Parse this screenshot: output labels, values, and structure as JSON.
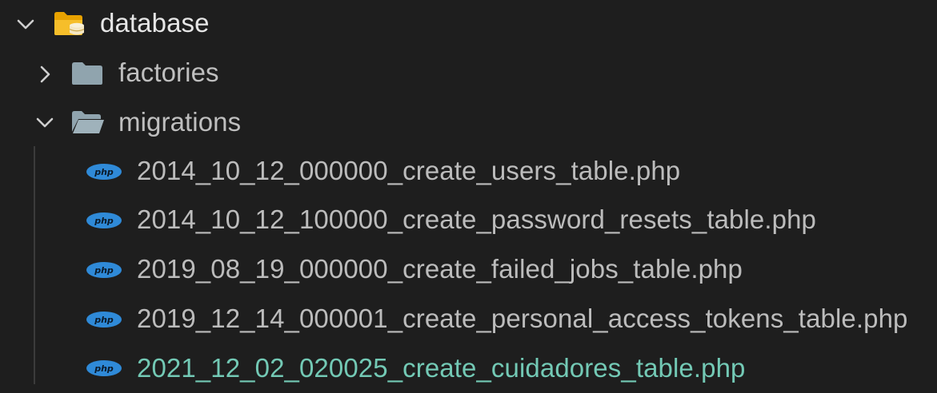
{
  "explorer": {
    "root": {
      "name": "database",
      "expanded": true,
      "icon": "database-folder-icon"
    },
    "folders": [
      {
        "name": "factories",
        "expanded": false,
        "icon": "folder-icon"
      },
      {
        "name": "migrations",
        "expanded": true,
        "icon": "folder-open-icon"
      }
    ],
    "files": [
      {
        "name": "2014_10_12_000000_create_users_table.php",
        "icon": "php-icon",
        "status": "normal"
      },
      {
        "name": "2014_10_12_100000_create_password_resets_table.php",
        "icon": "php-icon",
        "status": "normal"
      },
      {
        "name": "2019_08_19_000000_create_failed_jobs_table.php",
        "icon": "php-icon",
        "status": "normal"
      },
      {
        "name": "2019_12_14_000001_create_personal_access_tokens_table.php",
        "icon": "php-icon",
        "status": "normal"
      },
      {
        "name": "2021_12_02_020025_create_cuidadores_table.php",
        "icon": "php-icon",
        "status": "untracked"
      }
    ],
    "colors": {
      "background": "#1e1e1e",
      "folder": "#90a4ae",
      "root_folder": "#f4b400",
      "php_badge": "#2f8ad8",
      "untracked_text": "#73c9b5"
    }
  }
}
